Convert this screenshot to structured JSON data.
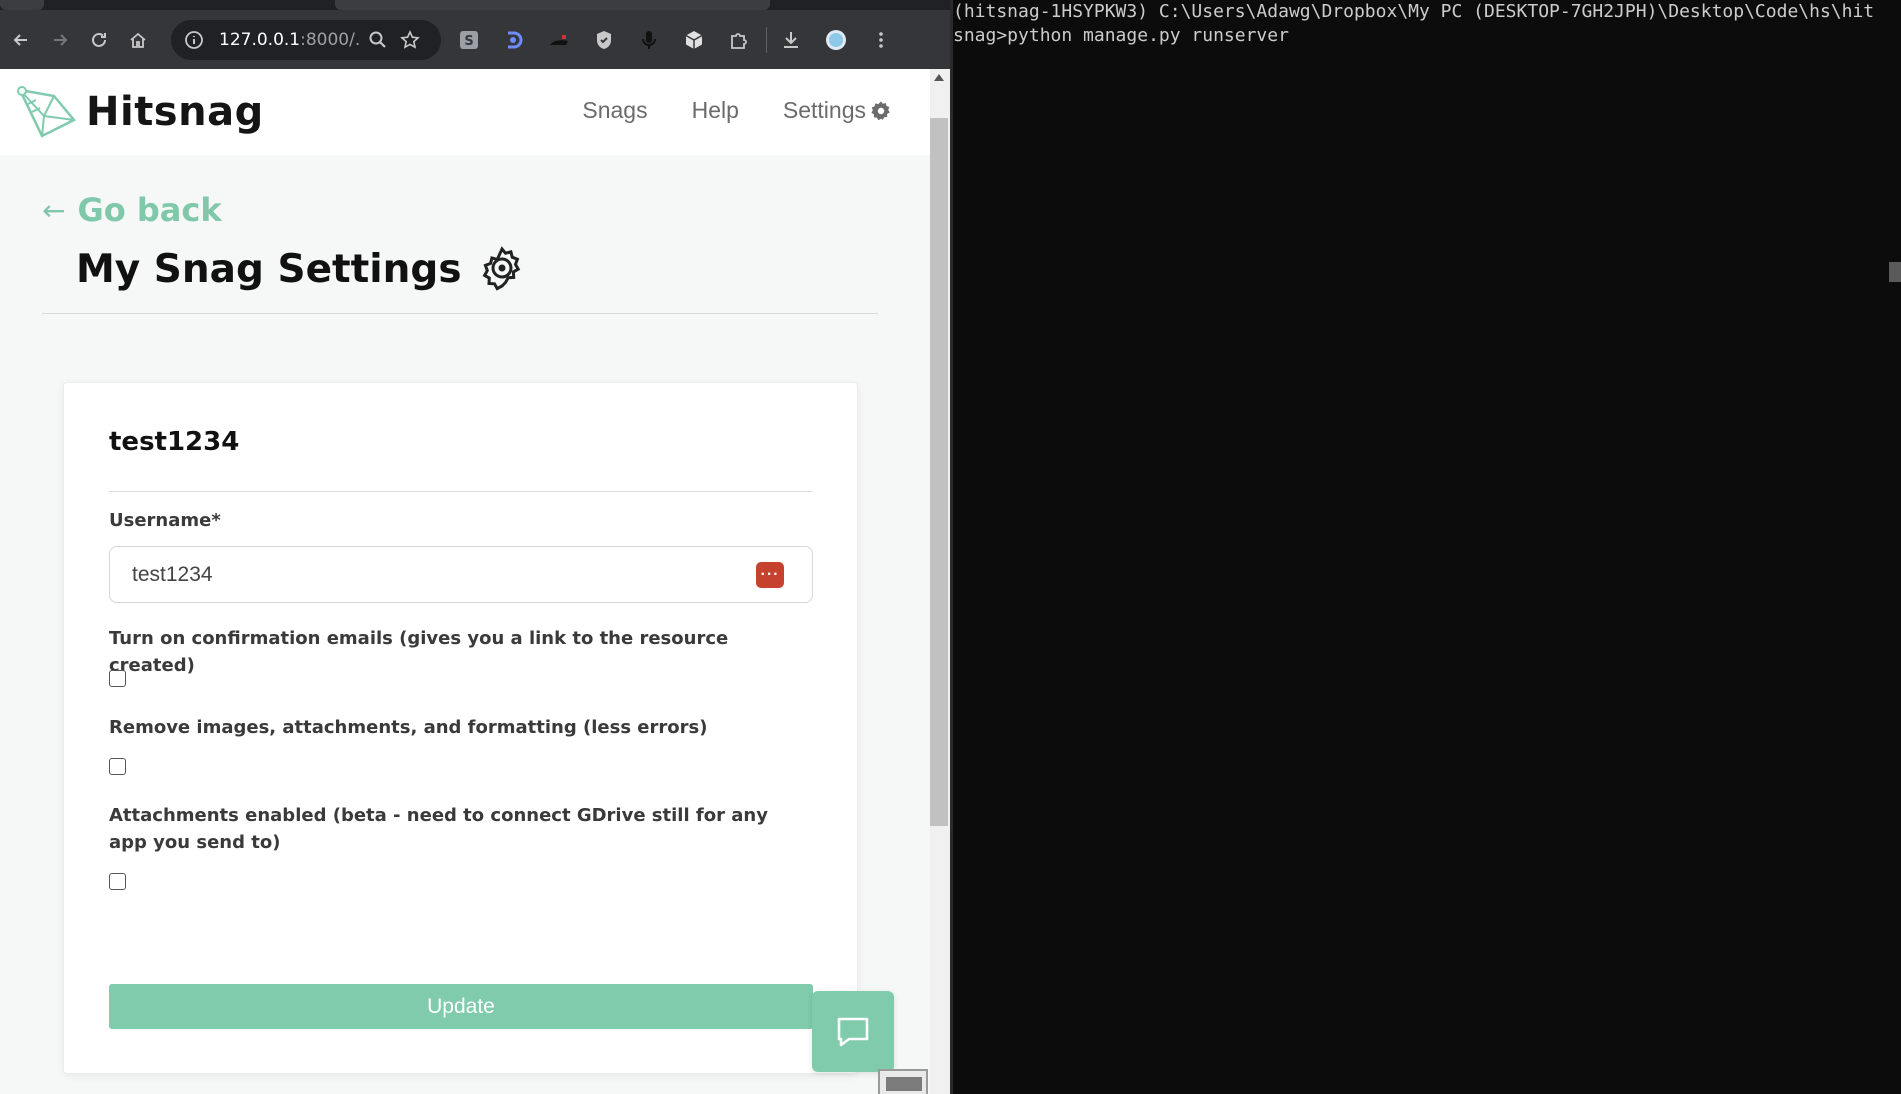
{
  "browser": {
    "url_host": "127.0.0.1",
    "url_rest": ":8000/...",
    "nav": {
      "back": "back-icon",
      "forward": "forward-icon",
      "reload": "reload-icon",
      "home": "home-icon"
    },
    "extensions": [
      "s-extension-icon",
      "d-extension-icon",
      "dark-extension-icon",
      "shield-extension-icon",
      "microphone-extension-icon",
      "cube-extension-icon",
      "puzzle-extensions-icon"
    ]
  },
  "site": {
    "brand_name": "Hitsnag",
    "nav_links": [
      "Snags",
      "Help",
      "Settings"
    ]
  },
  "page": {
    "go_back": "Go back",
    "go_back_arrow": "←",
    "title": "My Snag Settings"
  },
  "card": {
    "title": "test1234",
    "username_label": "Username*",
    "username_value": "test1234",
    "options": [
      {
        "label": "Turn on confirmation emails (gives you a link to the resource created)",
        "checked": false
      },
      {
        "label": "Remove images, attachments, and formatting (less errors)",
        "checked": false
      },
      {
        "label": "Attachments enabled (beta - need to connect GDrive still for any app you send to)",
        "checked": false
      }
    ],
    "submit_label": "Update"
  },
  "terminal": {
    "lines": [
      "(hitsnag-1HSYPKW3) C:\\Users\\Adawg\\Dropbox\\My PC (DESKTOP-7GH2JPH)\\Desktop\\Code\\hs\\hit",
      "snag>python manage.py runserver"
    ]
  },
  "colors": {
    "accent": "#7fcbac",
    "go_back": "#7fc8a9",
    "password_manager": "#c7412f"
  }
}
